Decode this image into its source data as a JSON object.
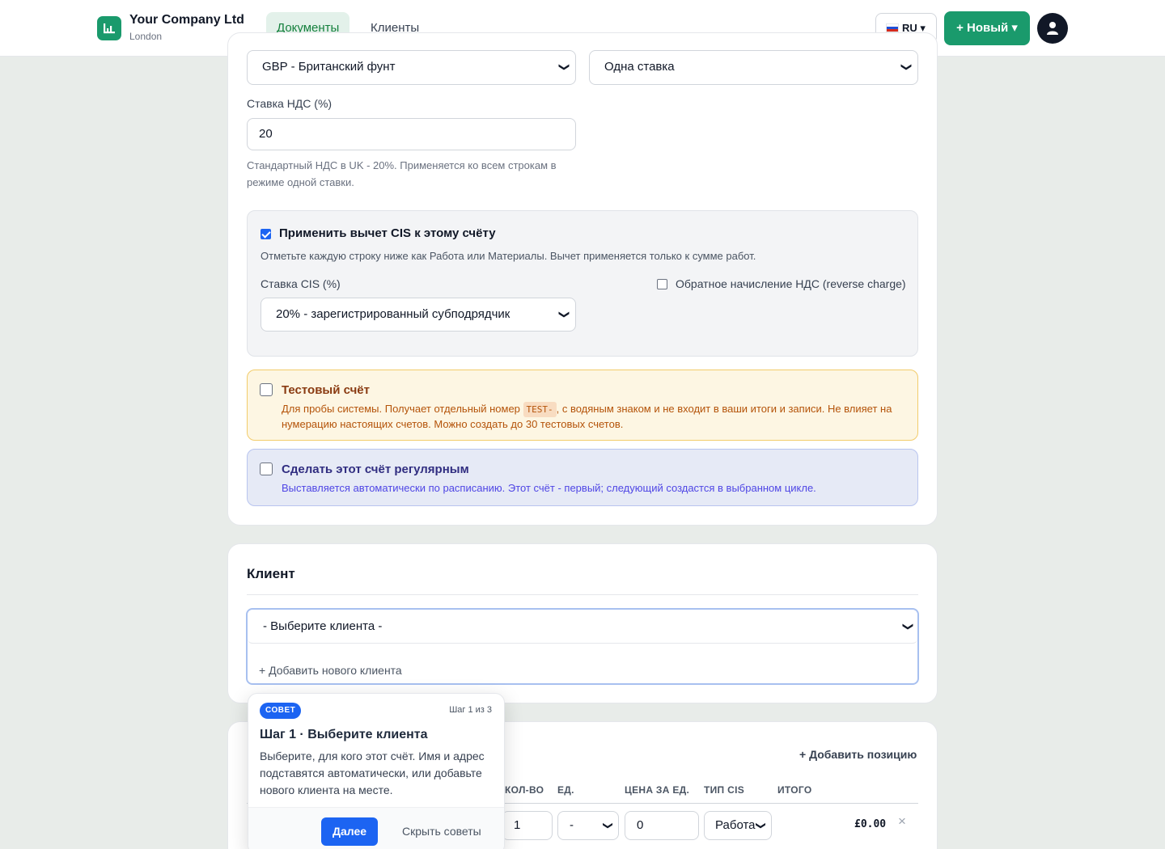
{
  "header": {
    "company_name": "Your Company Ltd",
    "company_city": "London",
    "tabs": [
      {
        "label": "Документы",
        "active": true
      },
      {
        "label": "Клиенты",
        "active": false
      }
    ],
    "language": "RU ▾",
    "new_button": "+ Новый ▾"
  },
  "settings": {
    "currency_value": "GBP - Британский фунт",
    "vat_mode_value": "Одна ставка",
    "vat_label": "Ставка НДС (%)",
    "vat_value": "20",
    "vat_help_1": "Стандартный НДС в UK - 20%. Применяется ко всем строкам в",
    "vat_help_2": "режиме одной ставки."
  },
  "cis": {
    "checked": true,
    "title": "Применить вычет CIS к этому счёту",
    "help": "Отметьте каждую строку ниже как Работа или Материалы. Вычет применяется только к сумме работ.",
    "rate_label": "Ставка CIS (%)",
    "rate_value": "20% - зарегистрированный субподрядчик",
    "reverse_charge_label": "Обратное начисление НДС (reverse charge)",
    "reverse_charge_checked": false
  },
  "test_invoice": {
    "checked": false,
    "title": "Тестовый счёт",
    "text_before": "Для пробы системы. Получает отдельный номер ",
    "code": "TEST-",
    "text_after": ", с водяным знаком и не входит в ваши итоги и записи. Не влияет на",
    "text_line2": "нумерацию настоящих счетов. Можно создать до 30 тестовых счетов."
  },
  "recurring": {
    "checked": false,
    "title": "Сделать этот счёт регулярным",
    "text": "Выставляется автоматически по расписанию. Этот счёт - первый; следующий создастся в выбранном цикле."
  },
  "client": {
    "section_title": "Клиент",
    "select_value": "- Выберите клиента -",
    "add_client": "+ Добавить нового клиента"
  },
  "items": {
    "add_item": "+ Добавить позицию",
    "columns": [
      "КОЛ-ВО",
      "ЕД.",
      "ЦЕНА ЗА ЕД.",
      "ТИП CIS",
      "ИТОГО"
    ],
    "row": {
      "qty": "1",
      "unit": "-",
      "price": "0",
      "cis_type": "Работа",
      "total": "£0.00",
      "remove": "×"
    }
  },
  "tip": {
    "badge": "СОВЕТ",
    "step": "Шаг 1 из 3",
    "title": "Шаг 1 · Выберите клиента",
    "text": "Выберите, для кого этот счёт. Имя и адрес подставятся автоматически, или добавьте нового клиента на месте.",
    "next": "Далее",
    "hide": "Скрыть советы"
  },
  "colors": {
    "brand": "#1a9a6c",
    "accent_blue": "#1c64f2",
    "page_bg": "#e8ece9"
  }
}
